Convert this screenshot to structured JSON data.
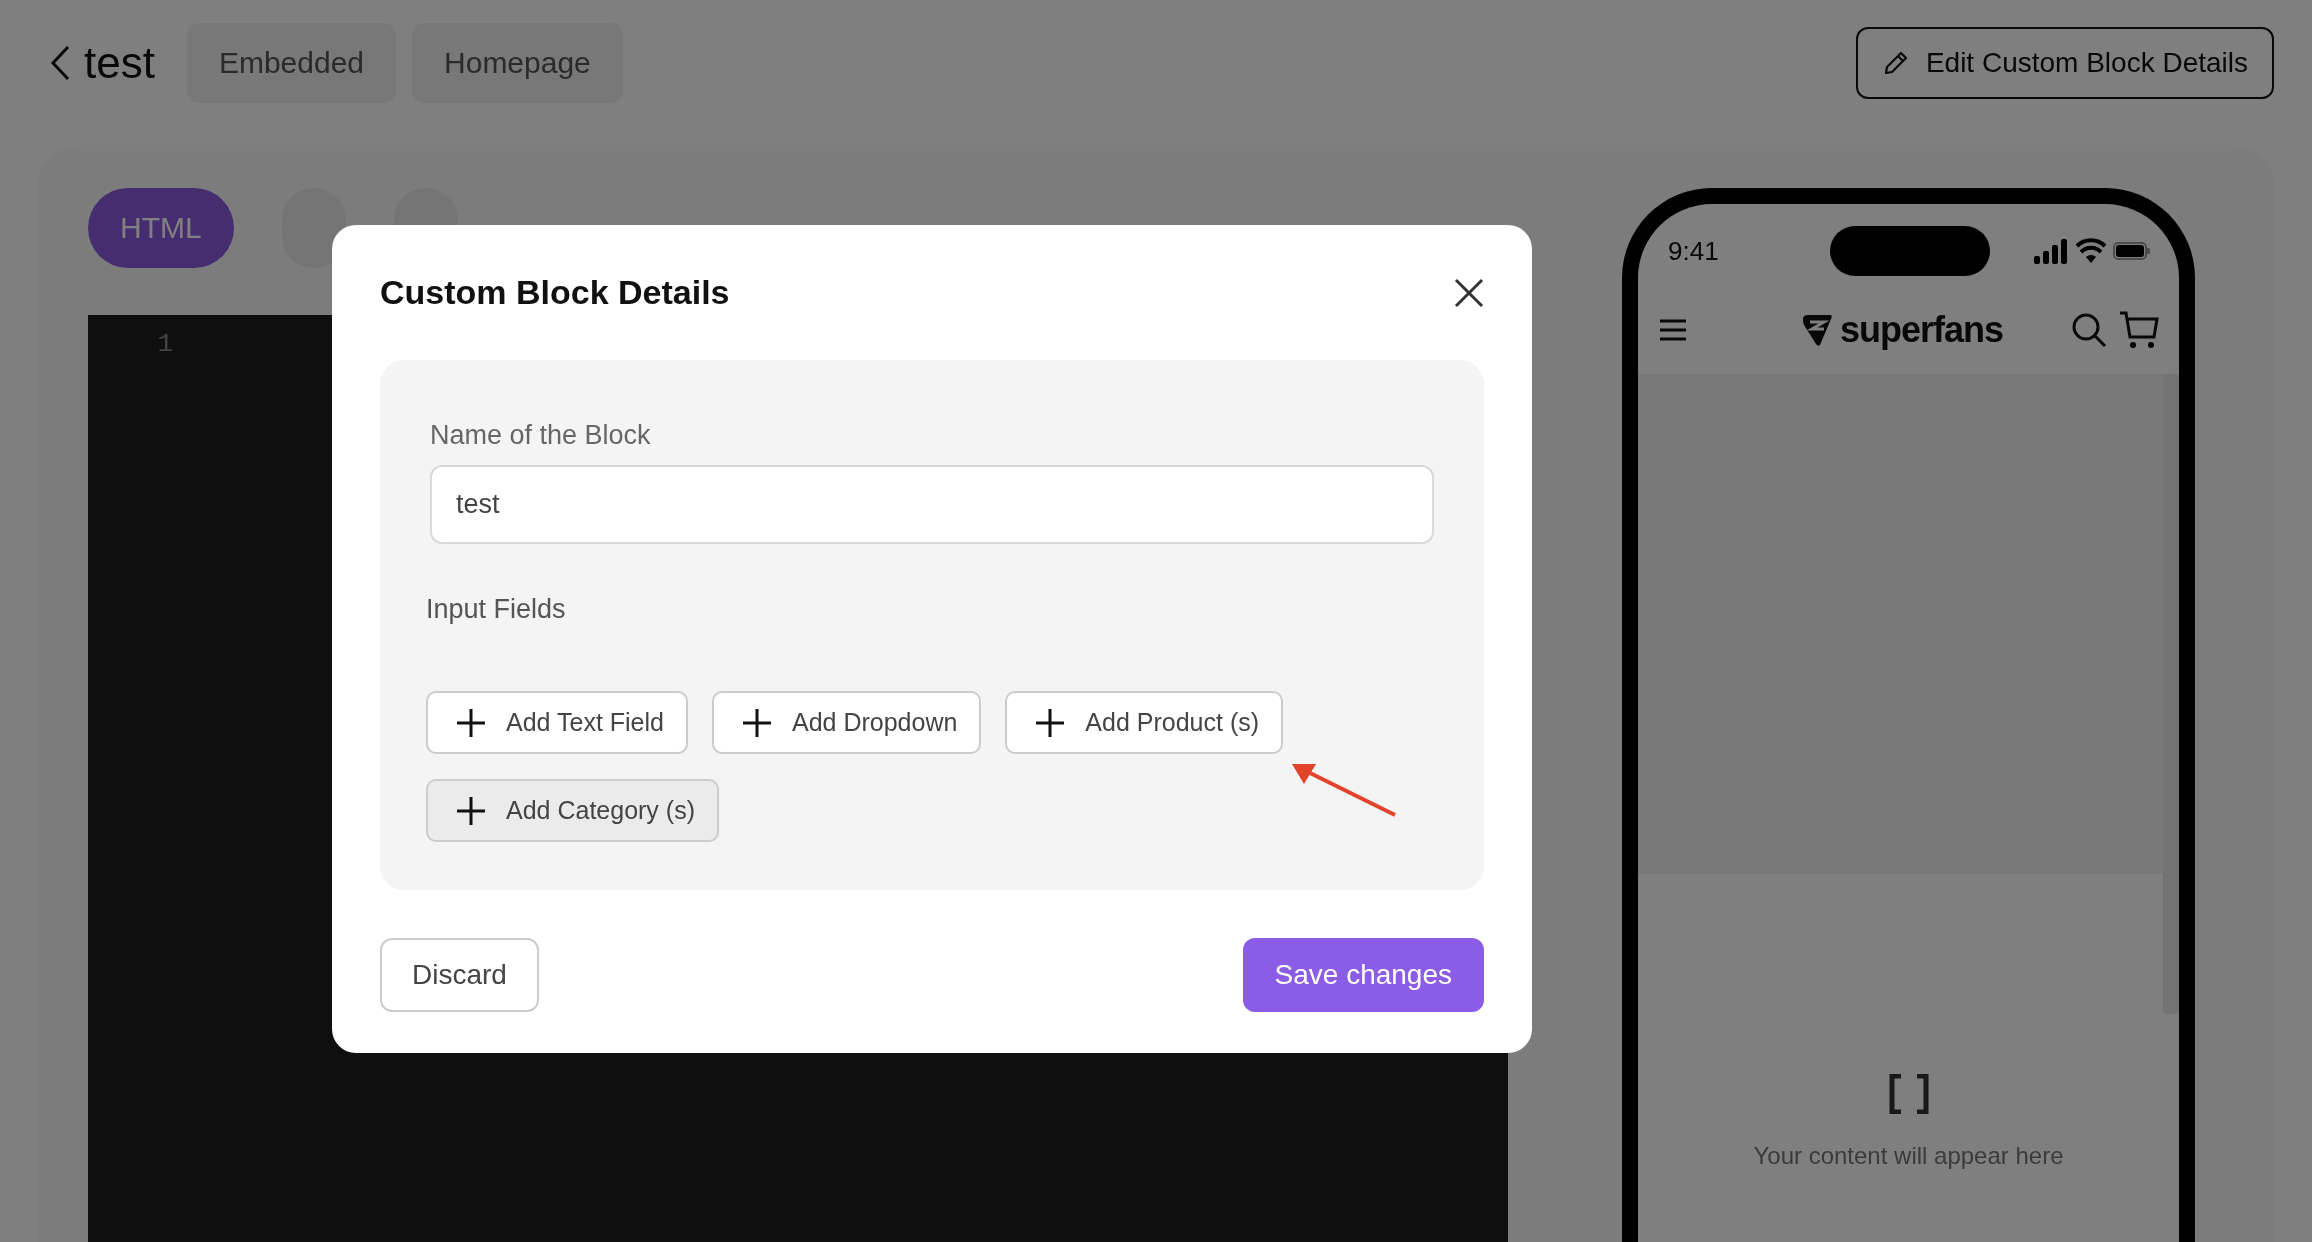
{
  "header": {
    "back_label": "test",
    "tags": [
      "Embedded",
      "Homepage"
    ],
    "edit_button": "Edit Custom Block Details"
  },
  "editor": {
    "tabs": [
      {
        "label": "HTML",
        "selected": true
      },
      {
        "selected": false
      },
      {
        "selected": false
      }
    ],
    "line_numbers": [
      "1"
    ]
  },
  "preview": {
    "time": "9:41",
    "brand": "superfans",
    "empty_message": "Your content will appear here"
  },
  "modal": {
    "title": "Custom Block Details",
    "name_label": "Name of the Block",
    "name_value": "test",
    "fields_label": "Input Fields",
    "add_buttons": [
      {
        "label": "Add Text Field",
        "hovered": false
      },
      {
        "label": "Add Dropdown",
        "hovered": false
      },
      {
        "label": "Add Product (s)",
        "hovered": false
      },
      {
        "label": "Add Category (s)",
        "hovered": true
      }
    ],
    "discard": "Discard",
    "save": "Save changes"
  }
}
